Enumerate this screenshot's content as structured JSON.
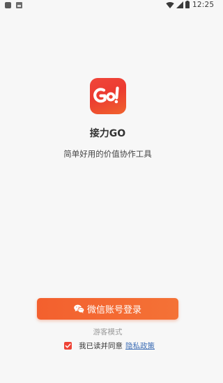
{
  "status_bar": {
    "time": "12:25",
    "icons": [
      "app-notification-icon",
      "image-notification-icon",
      "wifi-icon",
      "cell-signal-icon",
      "battery-icon"
    ]
  },
  "app": {
    "logo_text": "GO!",
    "name": "接力GO",
    "tagline": "简单好用的价值协作工具",
    "brand_color": "#f0463a",
    "button_color": "#f4692f",
    "link_color": "#3f6fb6"
  },
  "login": {
    "wechat_button_label": "微信账号登录",
    "wechat_icon": "wechat-icon",
    "guest_mode_label": "游客模式"
  },
  "agreement": {
    "checked": true,
    "text": "我已读并同意",
    "privacy_link": "隐私政策"
  }
}
